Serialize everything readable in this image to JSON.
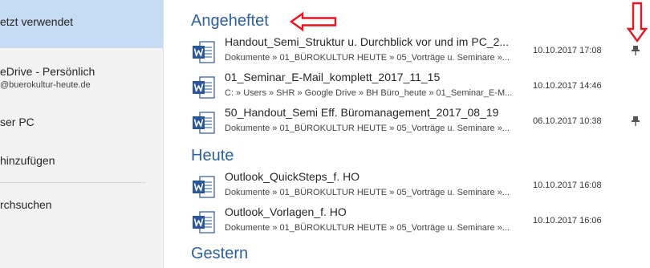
{
  "sidebar": {
    "items": [
      {
        "label": "etzt verwendet",
        "sub": ""
      },
      {
        "label": "eDrive - Persönlich",
        "sub": "@buerokultur-heute.de"
      },
      {
        "label": "ser PC",
        "sub": ""
      },
      {
        "label": " hinzufügen",
        "sub": ""
      },
      {
        "label": "rchsuchen",
        "sub": ""
      }
    ]
  },
  "sections": {
    "pinned": {
      "title": "Angeheftet",
      "files": [
        {
          "name": "Handout_Semi_Struktur u. Durchblick vor und im PC_2...",
          "path": "Dokumente » 01_BÜROKULTUR HEUTE » 05_Vorträge u. Seminare »...",
          "date": "10.10.2017 17:08"
        },
        {
          "name": "01_Seminar_E-Mail_komplett_2017_11_15",
          "path": "C: » Users » SHR » Google Drive » BH Büro_heute » 01_Seminar_E-M...",
          "date": "10.10.2017 14:46"
        },
        {
          "name": "50_Handout_Semi Eff. Büromanagement_2017_08_19",
          "path": "Dokumente » 01_BÜROKULTUR HEUTE » 05_Vorträge u. Seminare »...",
          "date": "06.10.2017 10:38"
        }
      ]
    },
    "today": {
      "title": "Heute",
      "files": [
        {
          "name": "Outlook_QuickSteps_f. HO",
          "path": "Dokumente » 01_BÜROKULTUR HEUTE » 05_Vorträge u. Seminare »...",
          "date": "10.10.2017 16:08"
        },
        {
          "name": "Outlook_Vorlagen_f. HO",
          "path": "Dokumente » 01_BÜROKULTUR HEUTE » 05_Vorträge u. Seminare »...",
          "date": "10.10.2017 16:06"
        }
      ]
    },
    "yesterday": {
      "title": "Gestern"
    }
  },
  "colors": {
    "accent": "#2e5f9e",
    "sidebar_active": "#c5daf3",
    "annotation_arrow": "#e8141f",
    "word_icon": "#2b579a"
  },
  "icons": {
    "file": "word-document-icon",
    "pin": "pin-icon"
  }
}
